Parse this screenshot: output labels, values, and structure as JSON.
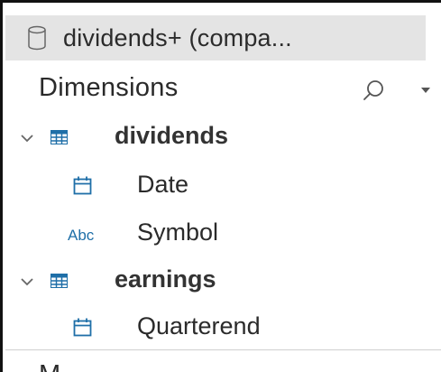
{
  "datasource": {
    "label": "dividends+ (compa...",
    "icon": "database-icon"
  },
  "dimensions": {
    "title": "Dimensions",
    "search_icon": "search-icon",
    "menu_icon": "dropdown-caret-icon"
  },
  "tree": [
    {
      "type": "table",
      "label": "dividends",
      "icon": "table-icon",
      "expanded": true
    },
    {
      "type": "field",
      "label": "Date",
      "icon": "calendar-icon"
    },
    {
      "type": "field",
      "label": "Symbol",
      "icon_text": "Abc"
    },
    {
      "type": "table",
      "label": "earnings",
      "icon": "table-icon",
      "expanded": true
    },
    {
      "type": "field",
      "label": "Quarterend",
      "icon": "calendar-icon"
    }
  ],
  "measures": {
    "title_partial": "M"
  },
  "colors": {
    "icon_blue": "#1f6fa8",
    "datasource_bg": "#e4e4e4",
    "text": "#2a2a2a"
  }
}
